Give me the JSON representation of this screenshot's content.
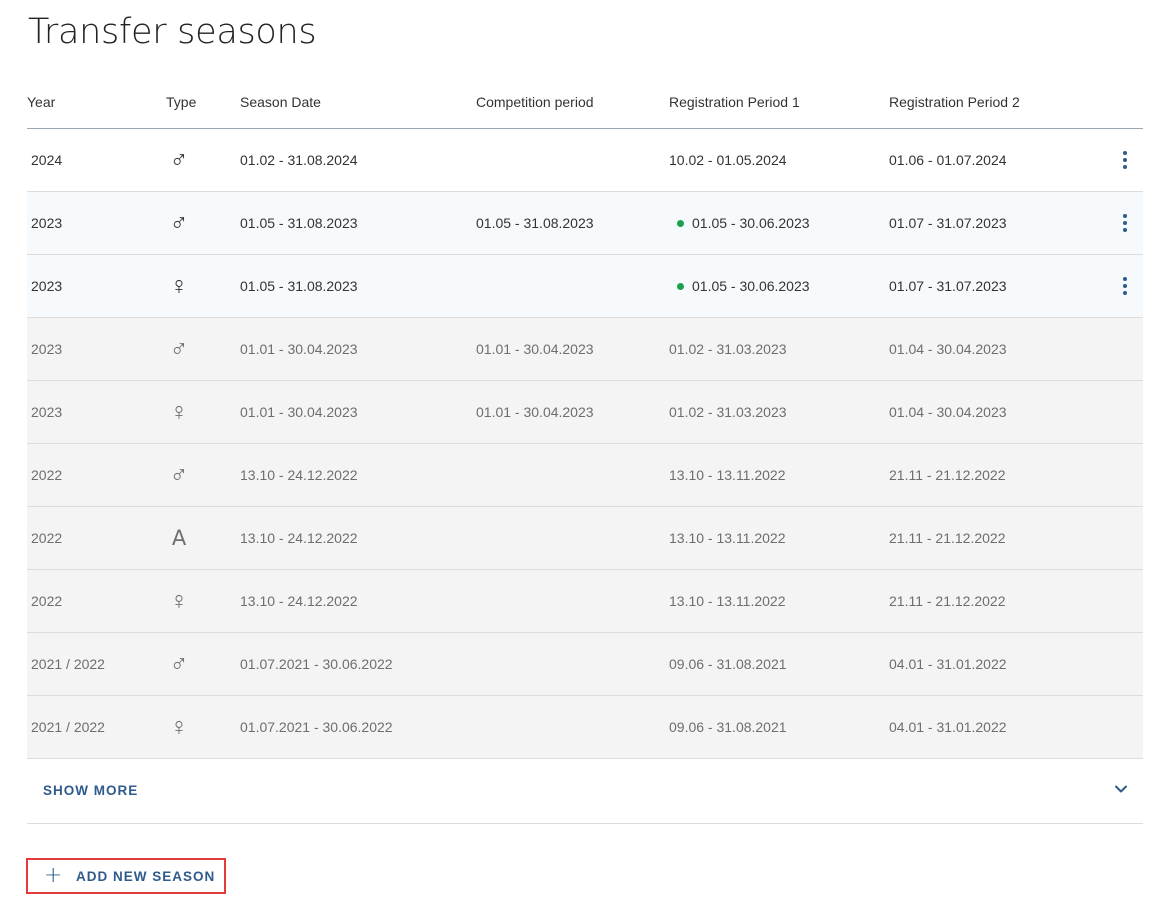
{
  "page": {
    "title": "Transfer seasons"
  },
  "table": {
    "headers": {
      "year": "Year",
      "type": "Type",
      "season_date": "Season Date",
      "competition_period": "Competition period",
      "registration_period_1": "Registration Period 1",
      "registration_period_2": "Registration Period 2"
    },
    "rows": [
      {
        "year": "2024",
        "type_symbol": "♂",
        "type_icon": "male-icon",
        "season_date": "01.02 - 31.08.2024",
        "competition_period": "",
        "registration_period_1": "10.02 - 01.05.2024",
        "registration_period_2": "01.06 - 01.07.2024",
        "state": "active",
        "reg1_active": false,
        "has_menu": true
      },
      {
        "year": "2023",
        "type_symbol": "♂",
        "type_icon": "male-icon",
        "season_date": "01.05 - 31.08.2023",
        "competition_period": "01.05 - 31.08.2023",
        "registration_period_1": "01.05 - 30.06.2023",
        "registration_period_2": "01.07 - 31.07.2023",
        "state": "highlight",
        "reg1_active": true,
        "has_menu": true
      },
      {
        "year": "2023",
        "type_symbol": "♀",
        "type_icon": "female-icon",
        "season_date": "01.05 - 31.08.2023",
        "competition_period": "",
        "registration_period_1": "01.05 - 30.06.2023",
        "registration_period_2": "01.07 - 31.07.2023",
        "state": "highlight",
        "reg1_active": true,
        "has_menu": true
      },
      {
        "year": "2023",
        "type_symbol": "♂",
        "type_icon": "male-icon",
        "season_date": "01.01 - 30.04.2023",
        "competition_period": "01.01 - 30.04.2023",
        "registration_period_1": "01.02 - 31.03.2023",
        "registration_period_2": "01.04 - 30.04.2023",
        "state": "past",
        "reg1_active": false,
        "has_menu": false
      },
      {
        "year": "2023",
        "type_symbol": "♀",
        "type_icon": "female-icon",
        "season_date": "01.01 - 30.04.2023",
        "competition_period": "01.01 - 30.04.2023",
        "registration_period_1": "01.02 - 31.03.2023",
        "registration_period_2": "01.04 - 30.04.2023",
        "state": "past",
        "reg1_active": false,
        "has_menu": false
      },
      {
        "year": "2022",
        "type_symbol": "♂",
        "type_icon": "male-icon",
        "season_date": "13.10 - 24.12.2022",
        "competition_period": "",
        "registration_period_1": "13.10 - 13.11.2022",
        "registration_period_2": "21.11 - 21.12.2022",
        "state": "past",
        "reg1_active": false,
        "has_menu": false
      },
      {
        "year": "2022",
        "type_symbol": "A",
        "type_icon": "all-genders-icon",
        "season_date": "13.10 - 24.12.2022",
        "competition_period": "",
        "registration_period_1": "13.10 - 13.11.2022",
        "registration_period_2": "21.11 - 21.12.2022",
        "state": "past",
        "reg1_active": false,
        "has_menu": false
      },
      {
        "year": "2022",
        "type_symbol": "♀",
        "type_icon": "female-icon",
        "season_date": "13.10 - 24.12.2022",
        "competition_period": "",
        "registration_period_1": "13.10 - 13.11.2022",
        "registration_period_2": "21.11 - 21.12.2022",
        "state": "past",
        "reg1_active": false,
        "has_menu": false
      },
      {
        "year": "2021 / 2022",
        "type_symbol": "♂",
        "type_icon": "male-icon",
        "season_date": "01.07.2021 - 30.06.2022",
        "competition_period": "",
        "registration_period_1": "09.06 - 31.08.2021",
        "registration_period_2": "04.01 - 31.01.2022",
        "state": "past",
        "reg1_active": false,
        "has_menu": false
      },
      {
        "year": "2021 / 2022",
        "type_symbol": "♀",
        "type_icon": "female-icon",
        "season_date": "01.07.2021 - 30.06.2022",
        "competition_period": "",
        "registration_period_1": "09.06 - 31.08.2021",
        "registration_period_2": "04.01 - 31.01.2022",
        "state": "past",
        "reg1_active": false,
        "has_menu": false
      }
    ],
    "show_more_label": "SHOW MORE",
    "show_more_icon": "chevron-down-icon"
  },
  "actions": {
    "add_label": "ADD NEW SEASON",
    "add_icon": "plus-icon"
  },
  "colors": {
    "accent": "#2f5b8c",
    "active_dot": "#1aa14b",
    "focus_outline": "#e53a3a"
  }
}
